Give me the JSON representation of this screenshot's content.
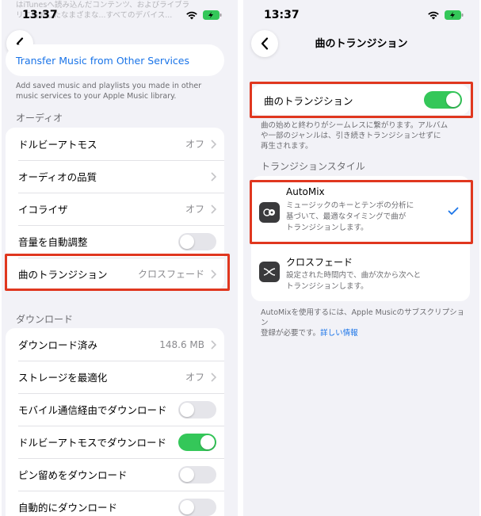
{
  "status_bar": {
    "time": "13:37"
  },
  "left_screen": {
    "faded_top_text_1": "はiTunesへ読み込んだコンテンツ、およびライブラ",
    "faded_top_text_2": "リに追加したなまざまな...すべてのデバイス...",
    "transfer_link": "Transfer Music from Other Services",
    "transfer_desc_1": "Add saved music and playlists you made in other",
    "transfer_desc_2": "music services to your Apple Music library.",
    "audio_section": {
      "title": "オーディオ",
      "rows": [
        {
          "label": "ドルビーアトモス",
          "value": "オフ"
        },
        {
          "label": "オーディオの品質",
          "value": ""
        },
        {
          "label": "イコライザ",
          "value": "オフ"
        },
        {
          "label": "音量を自動調整",
          "toggle": "off"
        },
        {
          "label": "曲のトランジション",
          "value": "クロスフェード"
        }
      ]
    },
    "download_section": {
      "title": "ダウンロード",
      "rows": [
        {
          "label": "ダウンロード済み",
          "value": "148.6 MB"
        },
        {
          "label": "ストレージを最適化",
          "value": "オフ"
        },
        {
          "label": "モバイル通信経由でダウンロード",
          "toggle": "off"
        },
        {
          "label": "ドルビーアトモスでダウンロード",
          "toggle": "on"
        },
        {
          "label": "ピン留めをダウンロード",
          "toggle": "off"
        },
        {
          "label": "自動的にダウンロード",
          "toggle": "off"
        }
      ]
    }
  },
  "right_screen": {
    "nav_title": "曲のトランジション",
    "transition_toggle": {
      "label": "曲のトランジション",
      "state": "on"
    },
    "transition_desc_1": "曲の始めと終わりがシームレスに繋がります。アルバム",
    "transition_desc_2": "や一部のジャンルは、引き続きトランジションせずに",
    "transition_desc_3": "再生されます。",
    "style_section_title": "トランジションスタイル",
    "styles": [
      {
        "title": "AutoMix",
        "desc_1": "ミュージックのキーとテンポの分析に",
        "desc_2": "基づいて、最適なタイミングで曲が",
        "desc_3": "トランジションします。",
        "selected": "true"
      },
      {
        "title": "クロスフェード",
        "desc_1": "設定された時間内で、曲が次から次へと",
        "desc_2": "トランジションします。",
        "selected": "false"
      }
    ],
    "footer_1": "AutoMixを使用するには、Apple Musicのサブスクリプション",
    "footer_2": "登録が必要です。",
    "footer_link": "詳しい情報"
  },
  "colors": {
    "accent_blue": "#1a74e8",
    "toggle_green": "#34c759",
    "highlight_red": "#e0371f",
    "background": "#f2f2f7"
  },
  "icons": [
    "chevron-left-icon",
    "chevron-right-icon",
    "wifi-icon",
    "battery-charging-icon",
    "checkmark-icon",
    "automix-icon",
    "crossfade-icon"
  ]
}
